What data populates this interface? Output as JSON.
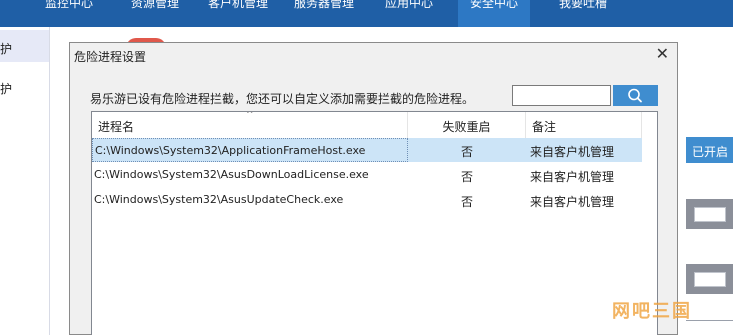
{
  "topnav": {
    "items": [
      {
        "label": "监控中心"
      },
      {
        "label": "资源管理"
      },
      {
        "label": "客户机管理"
      },
      {
        "label": "服务器管理"
      },
      {
        "label": "应用中心"
      },
      {
        "label": "安全中心",
        "active": true
      },
      {
        "label": "我要吐槽"
      }
    ]
  },
  "sidebar": {
    "items": [
      {
        "label": "护"
      },
      {
        "label": "护"
      }
    ]
  },
  "background": {
    "enabled_label": "已开启"
  },
  "dialog": {
    "title": "危险进程设置",
    "close_symbol": "✕",
    "info_text": "易乐游已设有危险进程拦截，您还可以自定义添加需要拦截的危险进程。",
    "search": {
      "value": "",
      "placeholder": ""
    },
    "table": {
      "columns": [
        "进程名",
        "失败重启",
        "备注"
      ],
      "rows": [
        {
          "path": "C:\\Windows\\System32\\ApplicationFrameHost.exe",
          "restart": "否",
          "note": "来自客户机管理",
          "selected": true
        },
        {
          "path": "C:\\Windows\\System32\\AsusDownLoadLicense.exe",
          "restart": "否",
          "note": "来自客户机管理"
        },
        {
          "path": "C:\\Windows\\System32\\AsusUpdateCheck.exe",
          "restart": "否",
          "note": "来自客户机管理"
        }
      ]
    }
  },
  "watermark": "网吧三国",
  "colors": {
    "nav_bg": "#1f5fa6",
    "nav_active": "#2d78c4",
    "accent": "#3f8dcf",
    "selected_row": "#cce4f7"
  },
  "icons": {
    "close": "close-icon",
    "search": "search-icon",
    "sort": "sort-up-icon"
  }
}
